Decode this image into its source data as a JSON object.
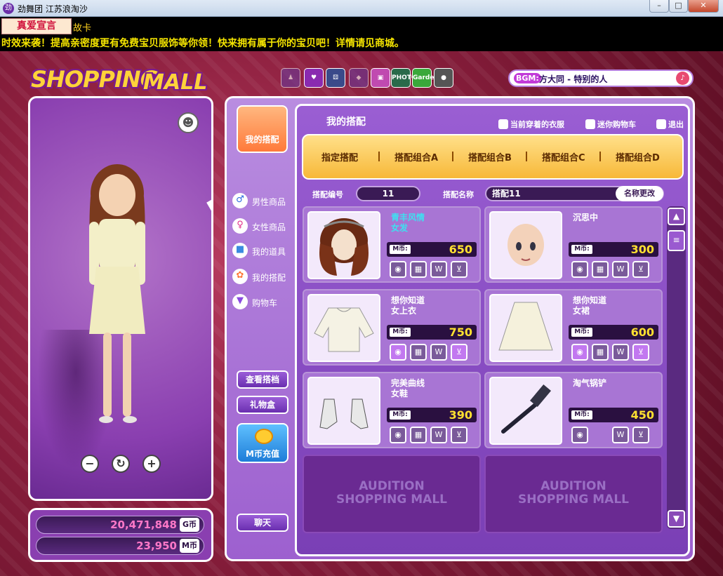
{
  "window": {
    "title": "劲舞团 江苏浪淘沙",
    "icon": "audition-app-icon"
  },
  "banner": {
    "tag": "真爱宣言",
    "extra": "故卡"
  },
  "marquee": "时效来袭！提高亲密度更有免费宝贝服饰等你领！快来拥有属于你的宝贝吧！详情请见商城。",
  "logo": {
    "word1": "SHOPPING",
    "word2": "MALL"
  },
  "topicons": [
    {
      "name": "shirt-icon",
      "label": ""
    },
    {
      "name": "bag-icon",
      "label": ""
    },
    {
      "name": "dice-icon",
      "label": ""
    },
    {
      "name": "gift-icon",
      "label": ""
    },
    {
      "name": "tv-icon",
      "label": ""
    },
    {
      "name": "photo-icon",
      "label": "PHOTO"
    },
    {
      "name": "garden-icon",
      "label": "Garden"
    },
    {
      "name": "bomb-icon",
      "label": ""
    }
  ],
  "bgm": {
    "label": "BGM:",
    "song": "方大同 - 特别的人"
  },
  "currency": {
    "g": "20,471,848",
    "g_unit": "G币",
    "m": "23,950",
    "m_unit": "M币"
  },
  "sidebar": {
    "my_combo": "我的搭配",
    "nav": [
      "男性商品",
      "女性商品",
      "我的道具",
      "我的搭配",
      "购物车"
    ],
    "view_btn": "查看搭档",
    "gift_btn": "礼物盒",
    "recharge": "M币充值",
    "chat": "聊天"
  },
  "content": {
    "title": "我的搭配",
    "links": [
      "当前穿着的衣服",
      "迷你购物车",
      "退出"
    ],
    "tabs": [
      "指定搭配",
      "搭配组合A",
      "搭配组合B",
      "搭配组合C",
      "搭配组合D"
    ],
    "no_label": "搭配编号",
    "no_value": "11",
    "name_label": "搭配名称",
    "name_value": "搭配11",
    "rename": "名称更改",
    "price_label": "M币:",
    "items": [
      {
        "n1": "青丰风情",
        "n2": "女发",
        "price": "650",
        "hl": true
      },
      {
        "n1": "沉思中",
        "n2": "",
        "price": "300",
        "hl": false
      },
      {
        "n1": "想你知道",
        "n2": "女上衣",
        "price": "750",
        "hl": false
      },
      {
        "n1": "想你知道",
        "n2": "女裙",
        "price": "600",
        "hl": false
      },
      {
        "n1": "完美曲线",
        "n2": "女鞋",
        "price": "390",
        "hl": false
      },
      {
        "n1": "淘气锅铲",
        "n2": "",
        "price": "450",
        "hl": false
      }
    ],
    "empty_text": [
      "AUDITION",
      "SHOPPING MALL"
    ]
  }
}
